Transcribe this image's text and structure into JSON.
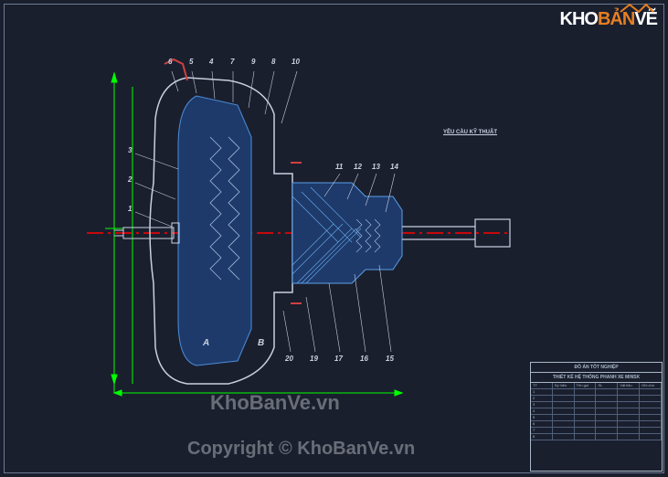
{
  "logo": {
    "text_kho": "KHO",
    "text_ban": "BẢN",
    "text_ve": "VẼ"
  },
  "watermark_center": "KhoBanVe.vn",
  "copyright": "Copyright © KhoBanVe.vn",
  "notes_heading": "YÊU CẦU KỸ THUẬT",
  "callouts_top": [
    "6",
    "5",
    "4",
    "7",
    "9",
    "8",
    "10"
  ],
  "callouts_left": [
    "3",
    "2",
    "1"
  ],
  "callouts_right": [
    "11",
    "12",
    "13",
    "14"
  ],
  "callouts_bottom": [
    "20",
    "19",
    "17",
    "16",
    "15"
  ],
  "zone_labels": {
    "A": "A",
    "B": "B"
  },
  "title_block": {
    "project": "ĐỒ ÁN TỐT NGHIỆP",
    "title": "THIẾT KẾ HỆ THỐNG PHANH XE MINSK",
    "rows": [
      [
        "TT",
        "Ký hiệu",
        "Tên gọi",
        "SL",
        "Vật liệu",
        "Ghi chú"
      ],
      [
        "1",
        "",
        "",
        "",
        "",
        ""
      ],
      [
        "2",
        "",
        "",
        "",
        "",
        ""
      ],
      [
        "3",
        "",
        "",
        "",
        "",
        ""
      ],
      [
        "4",
        "",
        "",
        "",
        "",
        ""
      ],
      [
        "5",
        "",
        "",
        "",
        "",
        ""
      ],
      [
        "6",
        "",
        "",
        "",
        "",
        ""
      ],
      [
        "7",
        "",
        "",
        "",
        "",
        ""
      ],
      [
        "8",
        "",
        "",
        "",
        "",
        ""
      ]
    ]
  }
}
